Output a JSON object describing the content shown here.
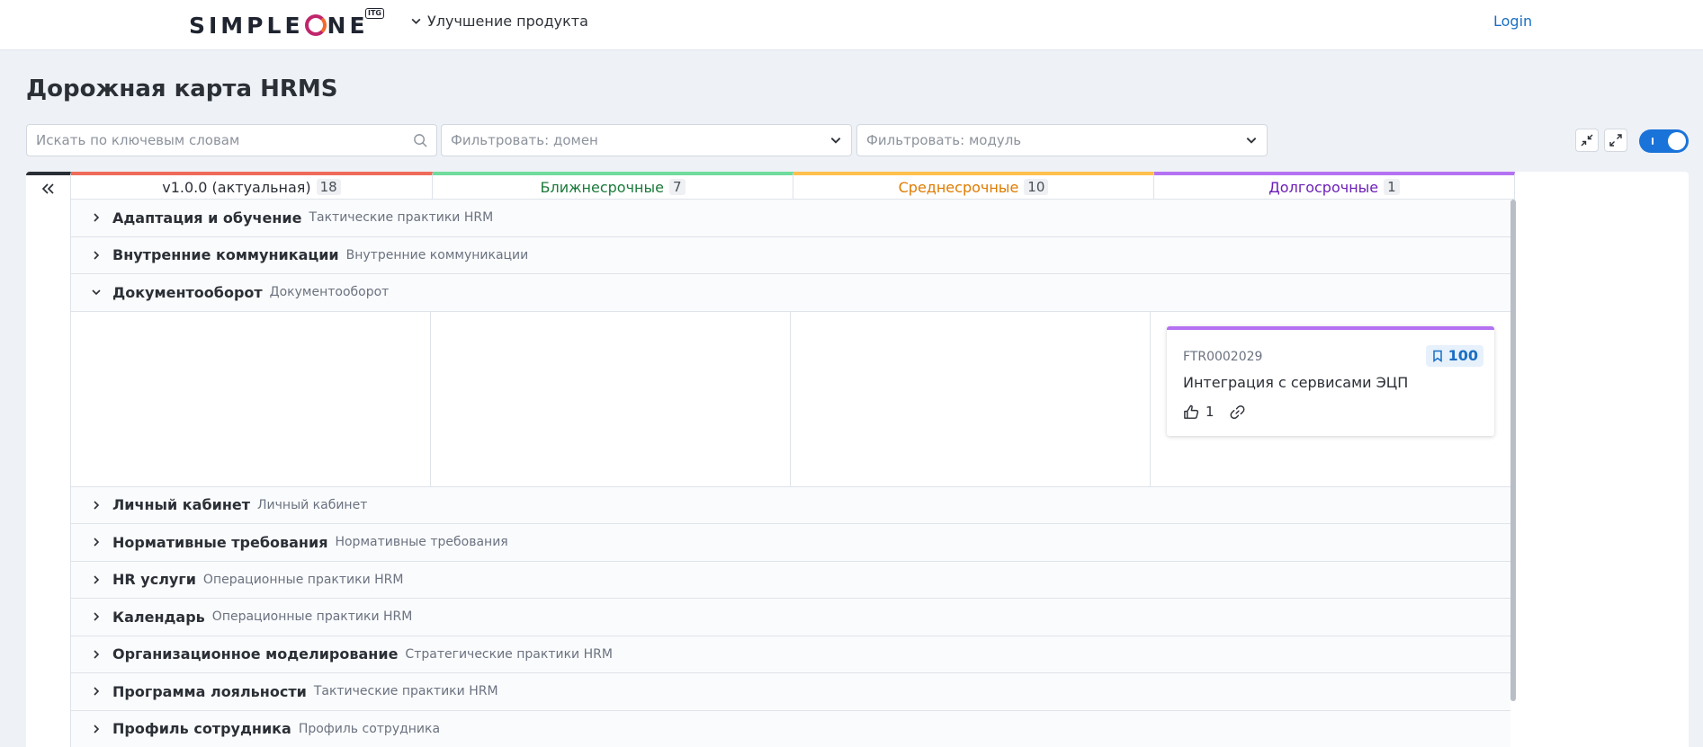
{
  "header": {
    "logo_text_left": "SIMPLE",
    "logo_text_right": "NE",
    "logo_badge": "ITG",
    "portal_menu": "Улучшение продукта",
    "login": "Login"
  },
  "page": {
    "title": "Дорожная карта HRMS"
  },
  "filters": {
    "search_placeholder": "Искать по ключевым словам",
    "domain_placeholder": "Фильтровать: домен",
    "module_placeholder": "Фильтровать: модуль",
    "toggle_on": true
  },
  "columns": [
    {
      "label": "v1.0.0 (актуальная)",
      "count": "18",
      "color": "#ef6b5a"
    },
    {
      "label": "Ближнесрочные",
      "count": "7",
      "color": "#6fdc9c"
    },
    {
      "label": "Среднесрочные",
      "count": "10",
      "color": "#ffc04d"
    },
    {
      "label": "Долгосрочные",
      "count": "1",
      "color": "#b472f2"
    }
  ],
  "groups_top": [
    {
      "name": "Адаптация и обучение",
      "sub": "Тактические практики HRM"
    },
    {
      "name": "Внутренние коммуникации",
      "sub": "Внутренние коммуникации"
    },
    {
      "name": "Документооборот",
      "sub": "Документооборот",
      "expanded": true
    }
  ],
  "card": {
    "number": "FTR0002029",
    "priority": "100",
    "title": "Интеграция с сервисами ЭЦП",
    "likes": "1"
  },
  "groups_bottom": [
    {
      "name": "Личный кабинет",
      "sub": "Личный кабинет"
    },
    {
      "name": "Нормативные требования",
      "sub": "Нормативные требования"
    },
    {
      "name": "HR услуги",
      "sub": "Операционные практики HRM"
    },
    {
      "name": "Календарь",
      "sub": "Операционные практики HRM"
    },
    {
      "name": "Организационное моделирование",
      "sub": "Стратегические практики HRM"
    },
    {
      "name": "Программа лояльности",
      "sub": "Тактические практики HRM"
    },
    {
      "name": "Профиль сотрудника",
      "sub": "Профиль сотрудника"
    }
  ]
}
